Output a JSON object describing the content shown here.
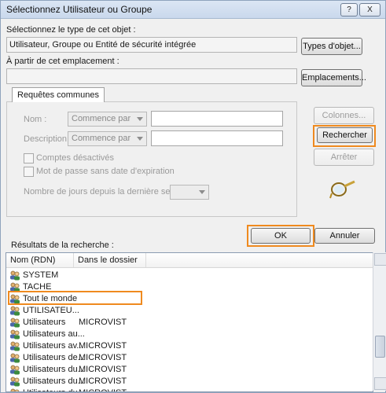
{
  "window": {
    "title": "Sélectionnez Utilisateur ou Groupe",
    "help_button": "?",
    "close_button": "X"
  },
  "object_type": {
    "label": "Sélectionnez le type de cet objet :",
    "value": "Utilisateur, Groupe ou Entité de sécurité intégrée",
    "button": "Types d'objet..."
  },
  "location": {
    "label": "À partir de cet emplacement :",
    "value": "",
    "button": "Emplacements..."
  },
  "common_queries": {
    "tab_label": "Requêtes communes",
    "name_label": "Nom :",
    "name_mode": "Commence par",
    "name_value": "",
    "description_label": "Description :",
    "description_mode": "Commence par",
    "description_value": "",
    "disabled_accounts_label": "Comptes désactivés",
    "non_expiring_password_label": "Mot de passe sans date d'expiration",
    "days_since_logon_label": "Nombre de jours depuis la dernière session :",
    "days_since_logon_value": ""
  },
  "side_buttons": {
    "columns": "Colonnes...",
    "search": "Rechercher",
    "stop": "Arrêter"
  },
  "actions": {
    "ok": "OK",
    "cancel": "Annuler"
  },
  "results": {
    "label": "Résultats de la recherche :",
    "columns": [
      "Nom (RDN)",
      "Dans le dossier"
    ],
    "rows": [
      {
        "name": "SYSTEM",
        "folder": ""
      },
      {
        "name": "TACHE",
        "folder": ""
      },
      {
        "name": "Tout le monde",
        "folder": ""
      },
      {
        "name": "UTILISATEU...",
        "folder": ""
      },
      {
        "name": "Utilisateurs",
        "folder": "MICROVIST"
      },
      {
        "name": "Utilisateurs au...",
        "folder": ""
      },
      {
        "name": "Utilisateurs av...",
        "folder": "MICROVIST"
      },
      {
        "name": "Utilisateurs de...",
        "folder": "MICROVIST"
      },
      {
        "name": "Utilisateurs du...",
        "folder": "MICROVIST"
      },
      {
        "name": "Utilisateurs du...",
        "folder": "MICROVIST"
      },
      {
        "name": "Utilisateurs du...",
        "folder": "MICROVIST"
      }
    ]
  },
  "colors": {
    "highlight": "#ef8a1f",
    "titlebar": "#c9d8ec"
  }
}
